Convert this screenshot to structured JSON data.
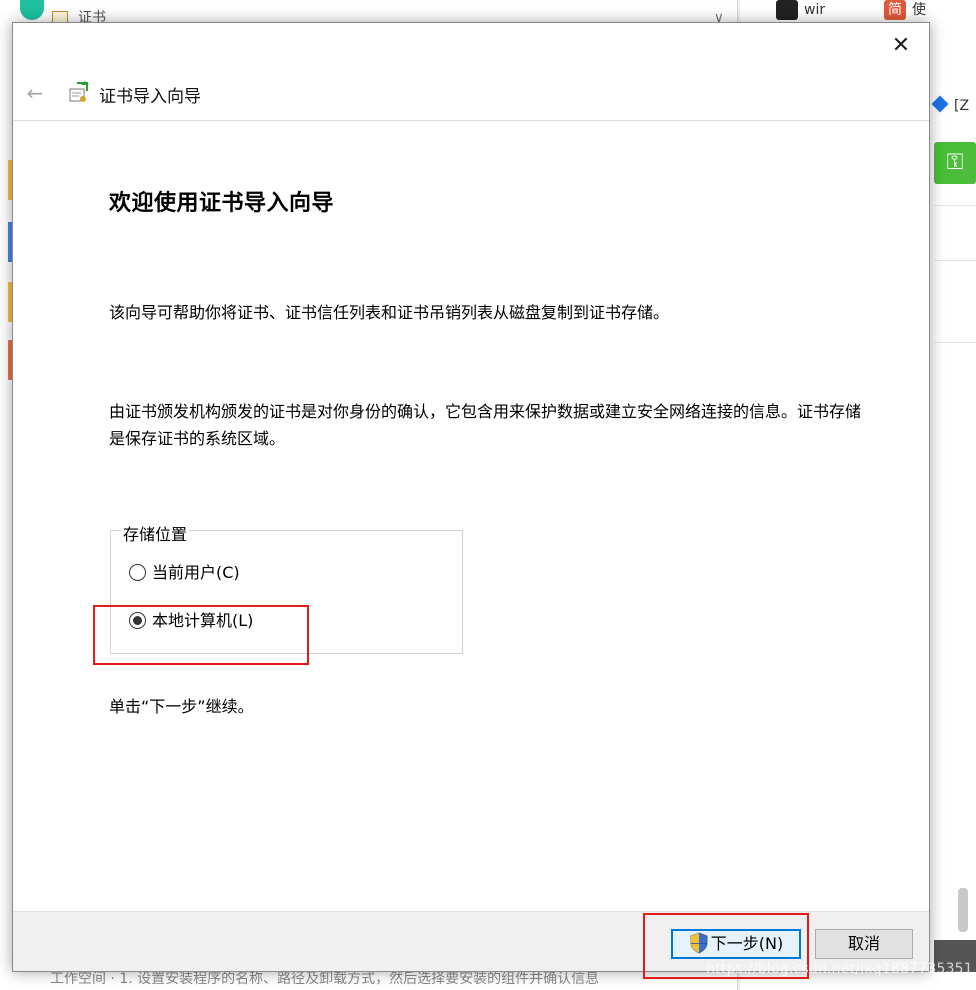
{
  "background": {
    "left_tab_title": "证书",
    "left_tab_close": "∨",
    "right_tab_1": "wir",
    "right_tab_2": "使",
    "right_tab_2_icon_text": "简",
    "right_item_text": "[Z",
    "right_green_icon": "key-icon",
    "bottom_text": "工作空间   ·   1. 设置安装程序的名称、路径及卸载方式，然后选择要安装的组件并确认信息",
    "watermark": "https://blog.csdn.net/lxq1887735351"
  },
  "dialog": {
    "close_label": "✕",
    "back_label": "←",
    "title": "证书导入向导",
    "heading": "欢迎使用证书导入向导",
    "paragraph_1": "该向导可帮助你将证书、证书信任列表和证书吊销列表从磁盘复制到证书存储。",
    "paragraph_2": "由证书颁发机构颁发的证书是对你身份的确认，它包含用来保护数据或建立安全网络连接的信息。证书存储是保存证书的系统区域。",
    "store_location": {
      "legend": "存储位置",
      "options": [
        {
          "label": "当前用户(C)",
          "checked": false
        },
        {
          "label": "本地计算机(L)",
          "checked": true
        }
      ]
    },
    "continue_hint": "单击“下一步”继续。",
    "buttons": {
      "next": "下一步(N)",
      "cancel": "取消"
    }
  },
  "colors": {
    "highlight": "#e31b1b",
    "default_button_border": "#0078d7"
  }
}
